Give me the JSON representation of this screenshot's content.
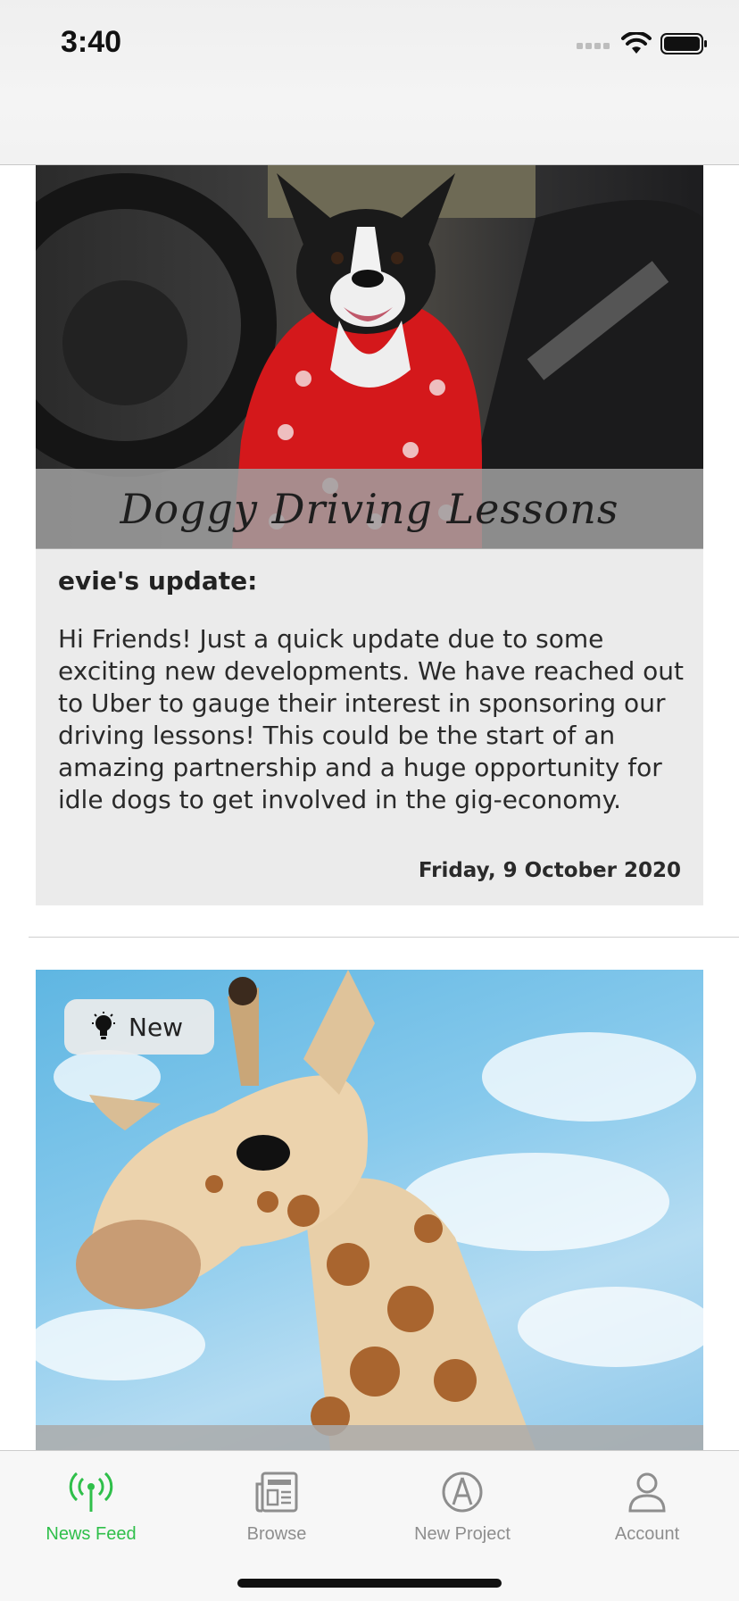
{
  "status_bar": {
    "time": "3:40"
  },
  "posts": [
    {
      "title": "Doggy Driving Lessons",
      "author": "evie's update:",
      "body": "Hi Friends! Just a quick update due to some exciting new developments. We have reached out to Uber to gauge their interest in sponsoring our driving lessons! This could be the start of an amazing partnership and a huge opportunity for idle dogs to get involved in the gig-economy.",
      "date": "Friday, 9 October 2020"
    },
    {
      "badge": "New"
    }
  ],
  "tabbar": {
    "items": [
      {
        "label": "News Feed",
        "icon": "antenna-icon",
        "active": true
      },
      {
        "label": "Browse",
        "icon": "newspaper-icon",
        "active": false
      },
      {
        "label": "New Project",
        "icon": "compass-pen-icon",
        "active": false
      },
      {
        "label": "Account",
        "icon": "person-icon",
        "active": false
      }
    ]
  },
  "colors": {
    "accent": "#2fbf4a",
    "inactive": "#8e8e8e",
    "card": "#ebebeb"
  }
}
